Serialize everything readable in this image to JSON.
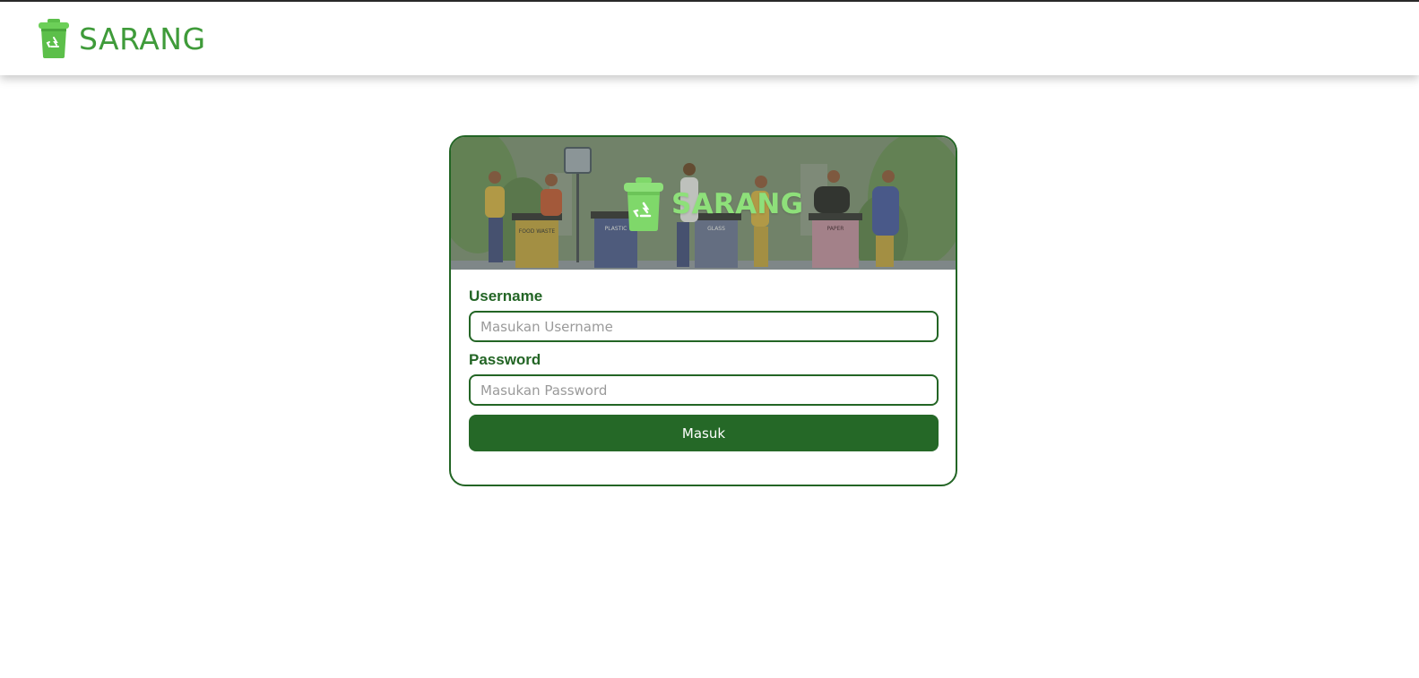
{
  "navbar": {
    "brand_name": "SARANG",
    "logo_icon": "recycle-bin-icon"
  },
  "login_card": {
    "banner": {
      "brand_name": "SARANG",
      "illustration": "people-sorting-recycling-bins",
      "bin_labels": [
        "FOOD WASTE",
        "PLASTIC",
        "GLASS",
        "PAPER"
      ]
    },
    "username_label": "Username",
    "username_placeholder": "Masukan Username",
    "username_value": "",
    "password_label": "Password",
    "password_placeholder": "Masukan Password",
    "password_value": "",
    "submit_label": "Masuk"
  },
  "colors": {
    "brand_green": "#3f9b3a",
    "primary_dark_green": "#256827",
    "border_green": "#236525",
    "banner_logo_green": "#8ee07a"
  }
}
